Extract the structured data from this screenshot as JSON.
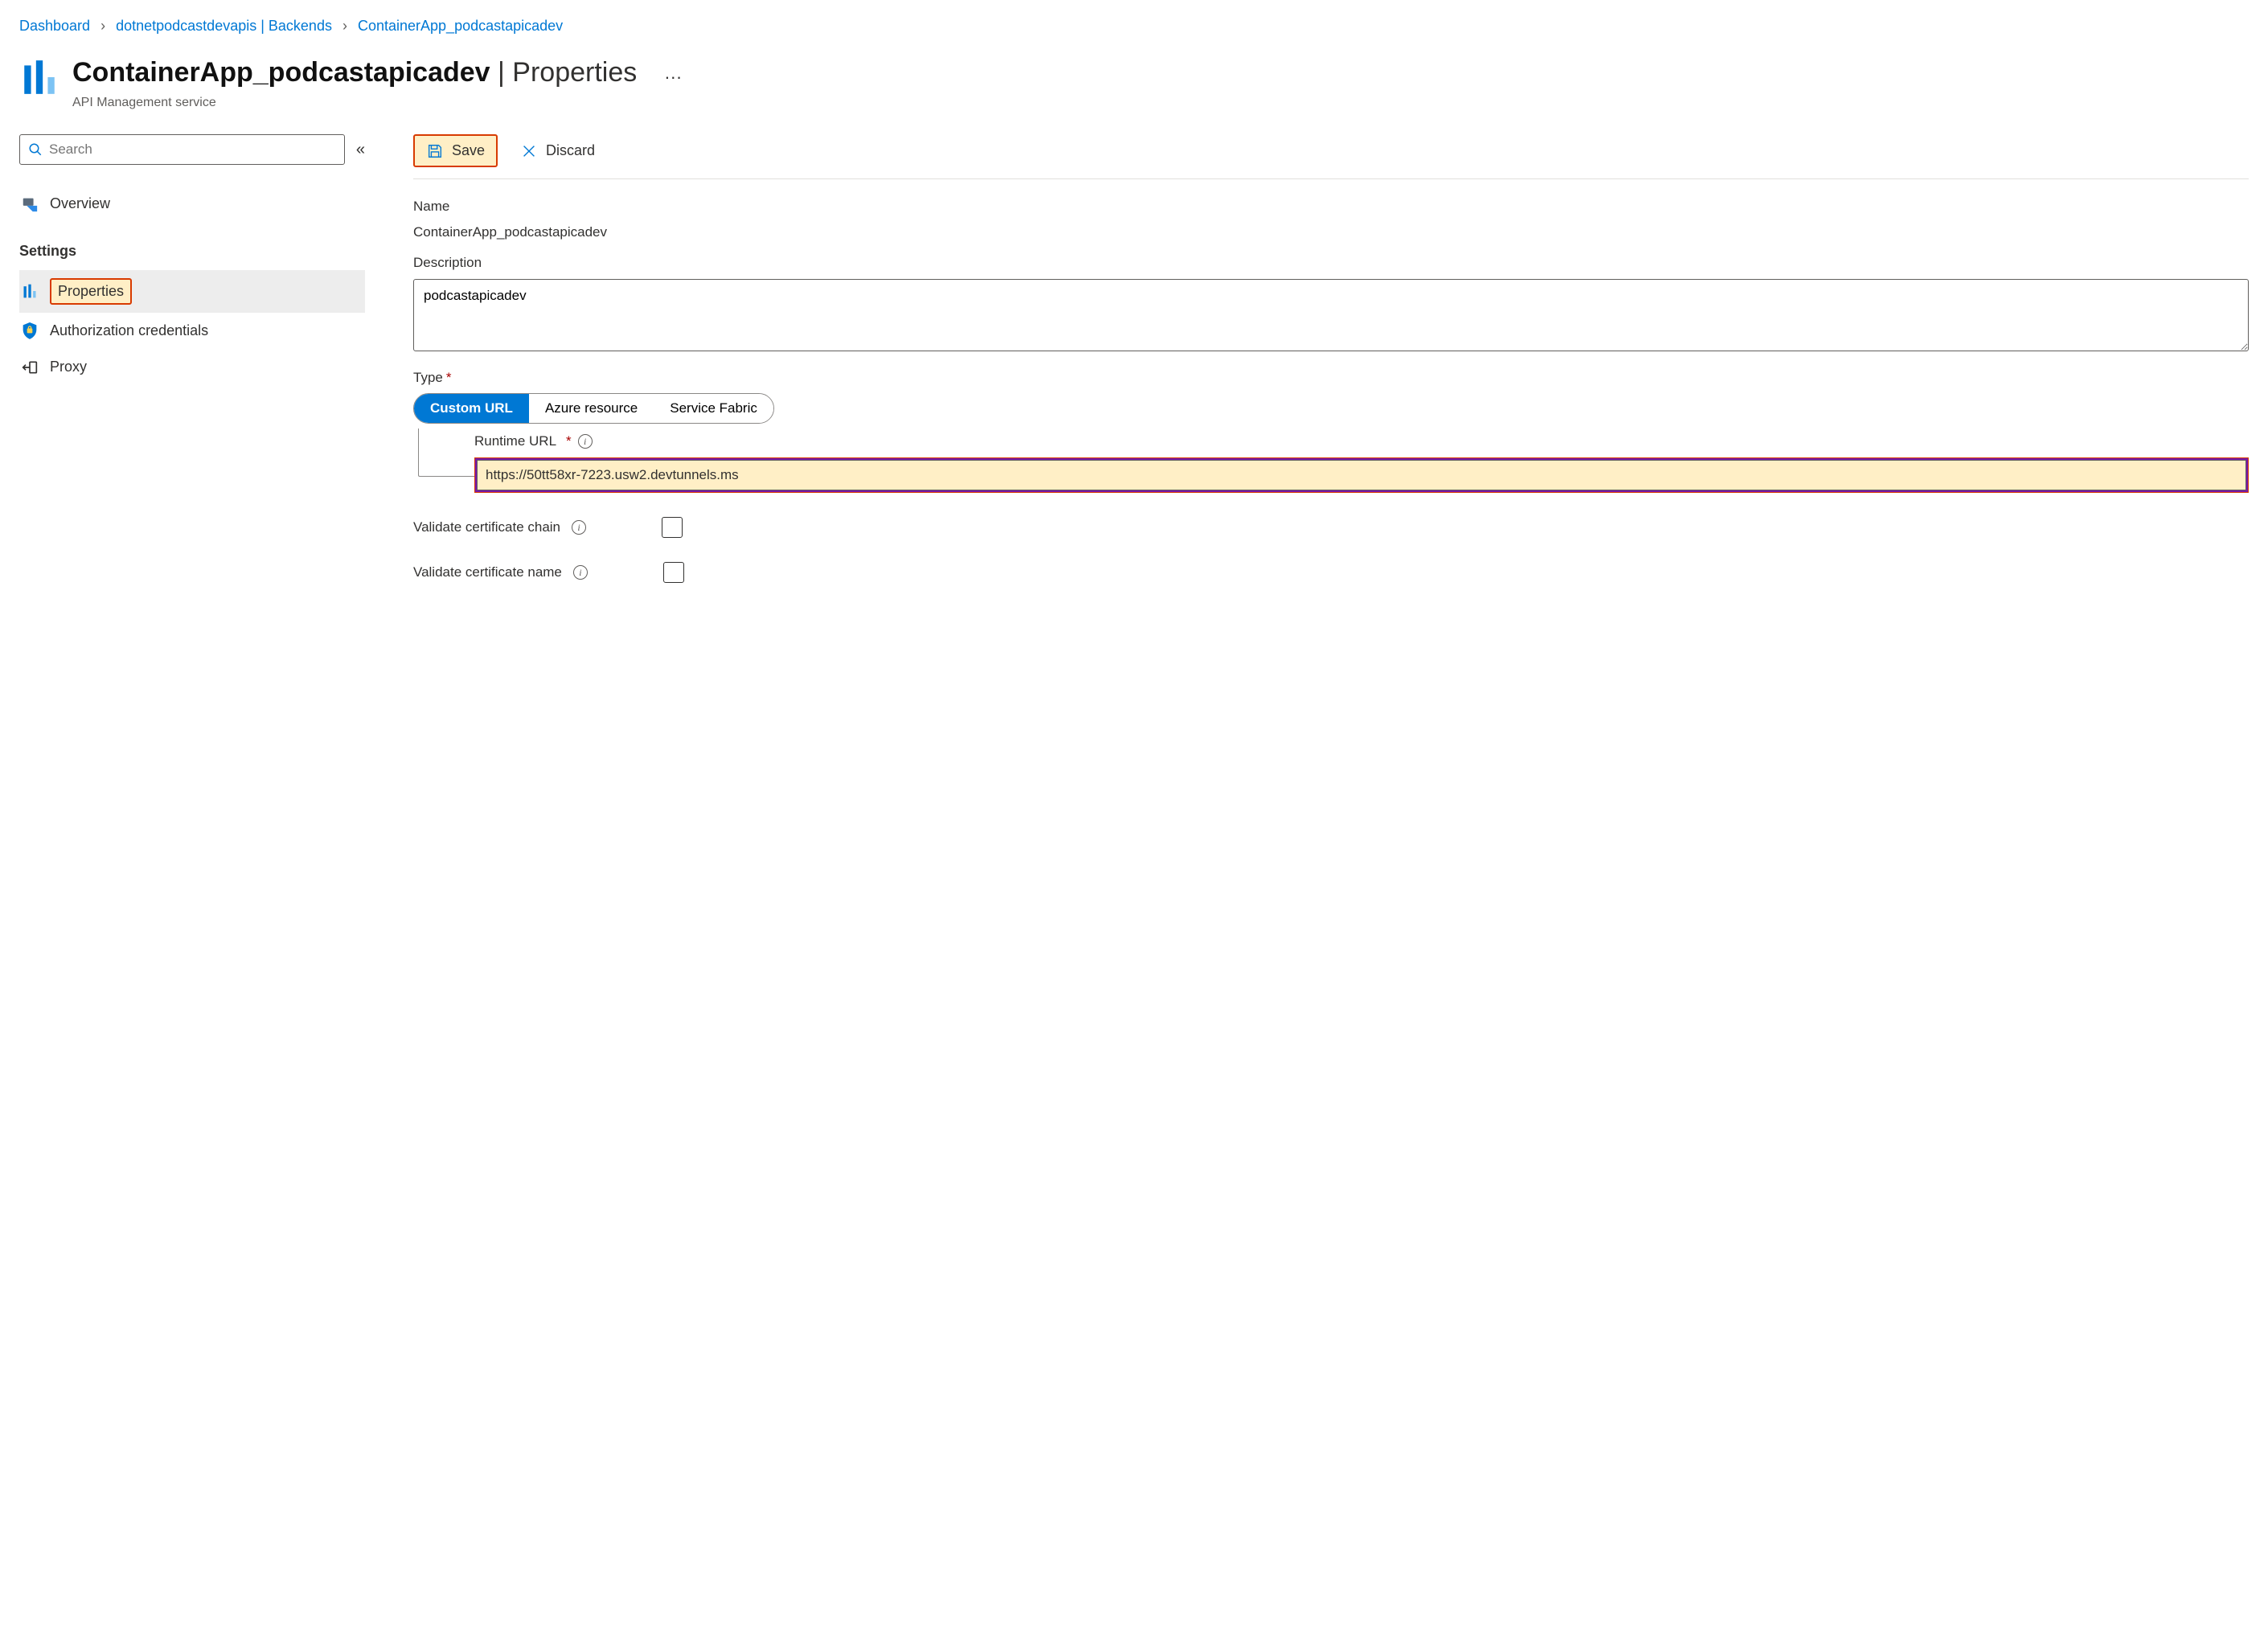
{
  "breadcrumb": {
    "items": [
      {
        "label": "Dashboard"
      },
      {
        "label": "dotnetpodcastdevapis | Backends"
      },
      {
        "label": "ContainerApp_podcastapicadev"
      }
    ]
  },
  "header": {
    "title_main": "ContainerApp_podcastapicadev",
    "title_divider": " | ",
    "title_section": "Properties",
    "subtitle": "API Management service",
    "overflow": "···"
  },
  "sidebar": {
    "search_placeholder": "Search",
    "collapse_glyph": "«",
    "overview_label": "Overview",
    "section_title": "Settings",
    "items": {
      "properties": "Properties",
      "auth": "Authorization credentials",
      "proxy": "Proxy"
    }
  },
  "toolbar": {
    "save_label": "Save",
    "discard_label": "Discard"
  },
  "form": {
    "name_label": "Name",
    "name_value": "ContainerApp_podcastapicadev",
    "description_label": "Description",
    "description_value": "podcastapicadev",
    "type_label": "Type",
    "type_options": {
      "custom_url": "Custom URL",
      "azure_resource": "Azure resource",
      "service_fabric": "Service Fabric"
    },
    "runtime_url_label": "Runtime URL",
    "runtime_url_value": "https://50tt58xr-7223.usw2.devtunnels.ms",
    "validate_chain_label": "Validate certificate chain",
    "validate_name_label": "Validate certificate name"
  }
}
